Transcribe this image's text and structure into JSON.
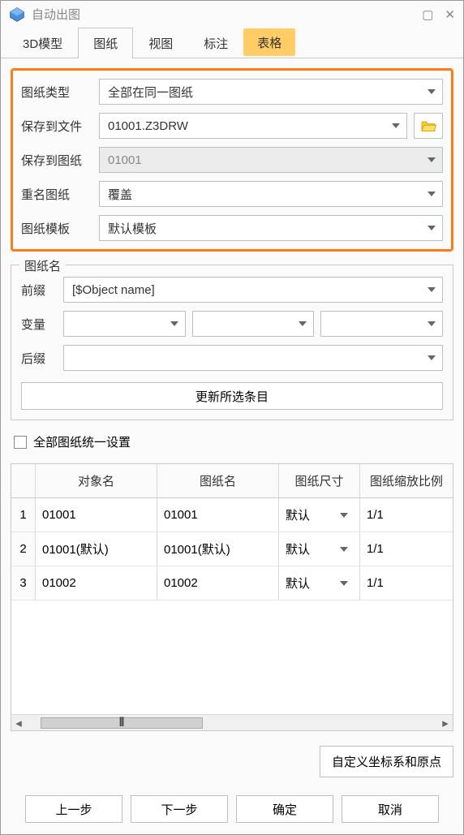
{
  "window": {
    "title": "自动出图"
  },
  "tabs": [
    "3D模型",
    "图纸",
    "视图",
    "标注",
    "表格"
  ],
  "activeTab": 1,
  "highlightTab": 4,
  "form": {
    "type_label": "图纸类型",
    "type_value": "全部在同一图纸",
    "savefile_label": "保存到文件",
    "savefile_value": "01001.Z3DRW",
    "savesheet_label": "保存到图纸",
    "savesheet_value": "01001",
    "rename_label": "重名图纸",
    "rename_value": "覆盖",
    "template_label": "图纸模板",
    "template_value": "默认模板"
  },
  "group": {
    "title": "图纸名",
    "prefix_label": "前缀",
    "prefix_value": "[$Object name]",
    "var_label": "变量",
    "var1": "",
    "var2": "",
    "var3": "",
    "suffix_label": "后缀",
    "suffix_value": "",
    "update_btn": "更新所选条目"
  },
  "check_all": "全部图纸统一设置",
  "table": {
    "headers": [
      "",
      "对象名",
      "图纸名",
      "图纸尺寸",
      "图纸缩放比例"
    ],
    "rows": [
      {
        "idx": "1",
        "obj": "01001",
        "name": "01001",
        "size": "默认",
        "scale": "1/1"
      },
      {
        "idx": "2",
        "obj": "01001(默认)",
        "name": "01001(默认)",
        "size": "默认",
        "scale": "1/1"
      },
      {
        "idx": "3",
        "obj": "01002",
        "name": "01002",
        "size": "默认",
        "scale": "1/1"
      }
    ]
  },
  "coord_btn": "自定义坐标系和原点",
  "footer": {
    "prev": "上一步",
    "next": "下一步",
    "ok": "确定",
    "cancel": "取消"
  }
}
